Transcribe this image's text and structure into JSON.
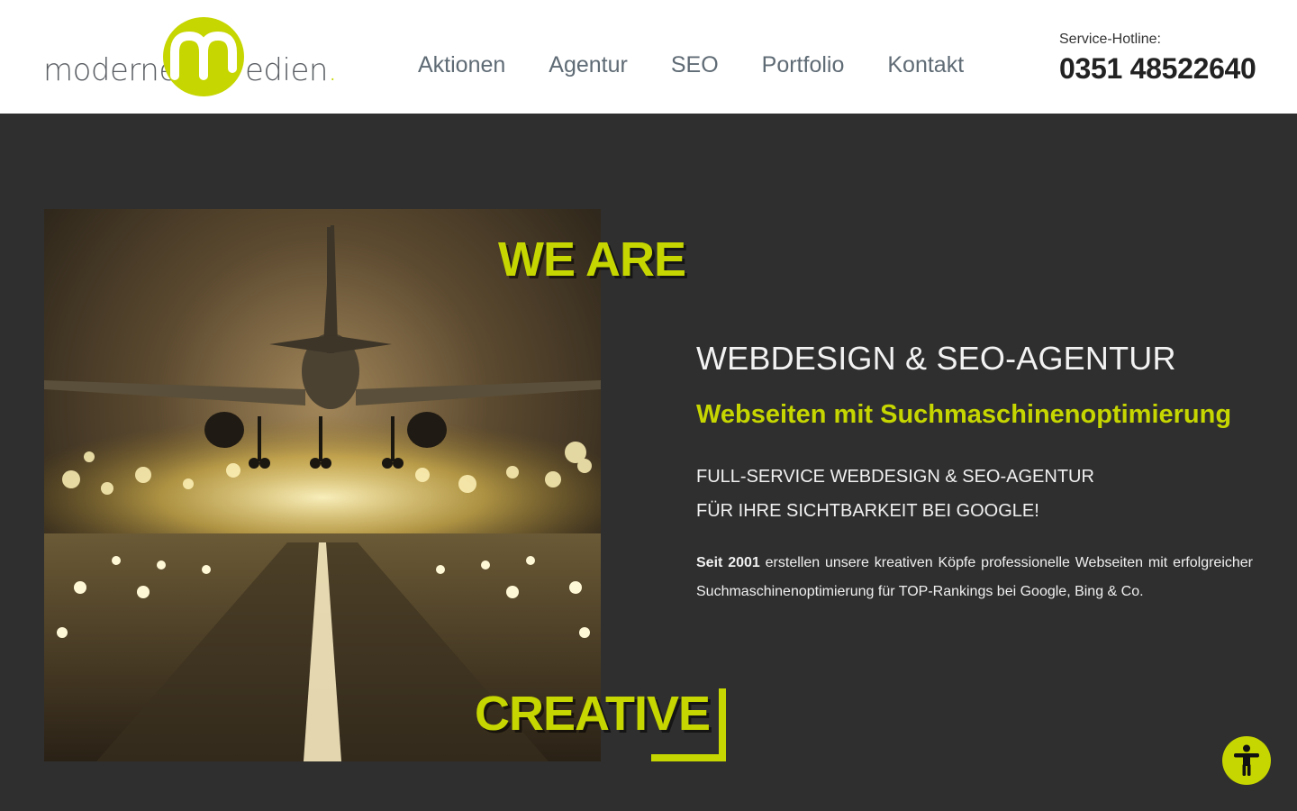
{
  "brand": {
    "logo_left": "moderne",
    "logo_right": "edien",
    "logo_dot": ".",
    "accent_color": "#c6d600",
    "header_bg": "#ffffff",
    "page_bg": "#2f2f2f"
  },
  "nav": {
    "items": [
      {
        "label": "Aktionen"
      },
      {
        "label": "Agentur"
      },
      {
        "label": "SEO"
      },
      {
        "label": "Portfolio"
      },
      {
        "label": "Kontakt"
      }
    ]
  },
  "hotline": {
    "label": "Service-Hotline:",
    "number": "0351 48522640"
  },
  "hero": {
    "overlay_top": "WE ARE",
    "overlay_bottom": "CREATIVE",
    "image_icon": "airplane-landing-runway-image"
  },
  "content": {
    "heading": "WEBDESIGN & SEO-AGENTUR",
    "subheading": "Webseiten mit Suchmaschinenoptimierung",
    "tagline_line1": "FULL-SERVICE WEBDESIGN & SEO-AGENTUR",
    "tagline_line2": "FÜR IHRE SICHTBARKEIT BEI GOOGLE!",
    "paragraph_bold": "Seit 2001",
    "paragraph_rest": " erstellen unsere kreativen Köpfe professionelle Webseiten mit erfolgreicher Suchmaschinenoptimierung für TOP-Rankings bei Google, Bing & Co."
  },
  "accessibility": {
    "icon": "accessibility-person-icon"
  }
}
